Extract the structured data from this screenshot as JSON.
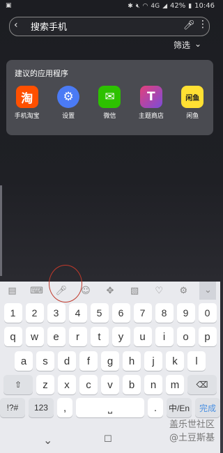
{
  "status": {
    "time": "10:46",
    "battery": "42%",
    "network": "4G"
  },
  "search": {
    "placeholder": "搜索手机"
  },
  "filter": {
    "label": "筛选"
  },
  "suggested": {
    "title": "建议的应用程序",
    "apps": [
      {
        "label": "手机淘宝",
        "glyph": "淘",
        "color": "#ff5000"
      },
      {
        "label": "设置",
        "glyph": "⚙",
        "color": "#4b7bf5"
      },
      {
        "label": "微信",
        "glyph": "✉",
        "color": "#2dc100"
      },
      {
        "label": "主题商店",
        "glyph": "T",
        "color": "#e3407a"
      },
      {
        "label": "闲鱼",
        "glyph": "闲鱼",
        "color": "#ffe033"
      }
    ]
  },
  "keyboard": {
    "row_numbers": [
      "1",
      "2",
      "3",
      "4",
      "5",
      "6",
      "7",
      "8",
      "9",
      "0"
    ],
    "row1": [
      "q",
      "w",
      "e",
      "r",
      "t",
      "y",
      "u",
      "i",
      "o",
      "p"
    ],
    "row2": [
      "a",
      "s",
      "d",
      "f",
      "g",
      "h",
      "j",
      "k",
      "l"
    ],
    "row3": [
      "z",
      "x",
      "c",
      "v",
      "b",
      "n",
      "m"
    ],
    "symbols": "!?#",
    "num": "123",
    "lang": "中/En",
    "done": "完成"
  },
  "watermark": {
    "line1": "盖乐世社区",
    "line2": "@土豆斯基"
  }
}
